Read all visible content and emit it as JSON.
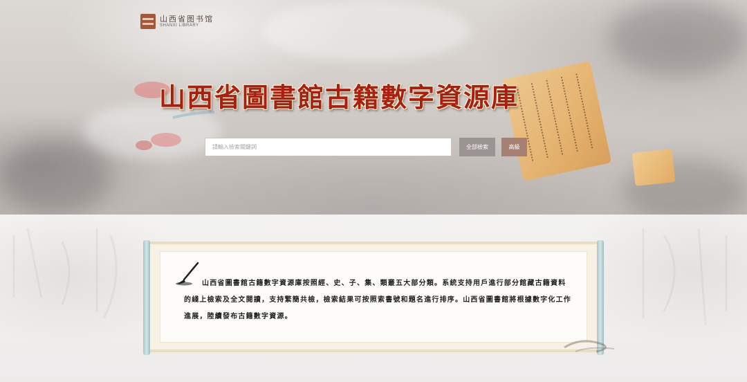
{
  "header": {
    "logo": {
      "name_cn": "山西省图书馆",
      "name_en": "SHANXI LIBRARY"
    },
    "title": "山西省圖書館古籍數字資源庫"
  },
  "search": {
    "placeholder": "請輸入檢索關鍵詞",
    "value": "",
    "search_button_label": "全部檢索",
    "advanced_button_label": "高級"
  },
  "intro": {
    "text": "山西省圖書館古籍數字資源庫按照經、史、子、集、類叢五大部分類。系統支持用戶進行部分館藏古籍資料的綫上檢索及全文閱讀，支持繁簡共檢，檢索結果可按照索書號和題名進行排序。山西省圖書館將根據數字化工作進展，陸續發布古籍數字資源。"
  },
  "colors": {
    "title_red": "#a8200f",
    "search_button": "#9b9493",
    "advanced_button": "#a78074",
    "scroll_rod": "#a4c7c9"
  },
  "icons": {
    "logo": "library-logo-icon",
    "pen": "brush-pen-icon"
  }
}
